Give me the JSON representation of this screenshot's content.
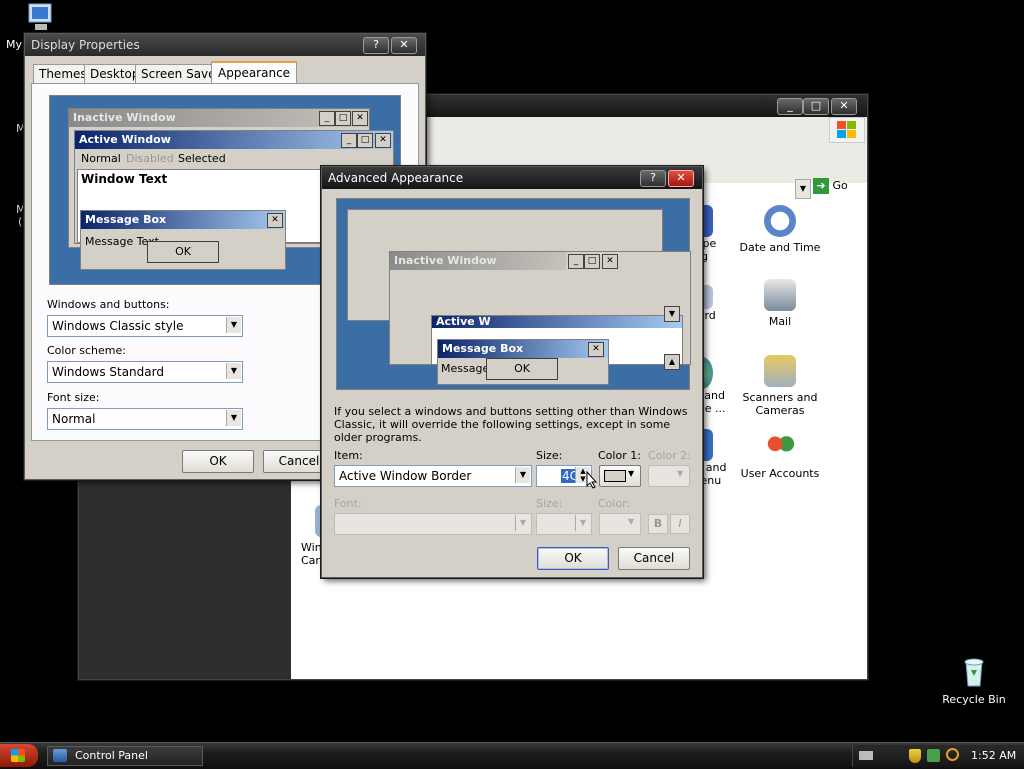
{
  "desktop": {
    "icons": {
      "my_computer_label": "My",
      "recycle_bin_label": "Recycle Bin"
    },
    "edge_letters": [
      "M",
      "M",
      "("
    ]
  },
  "control_panel": {
    "go_label": "Go",
    "items": [
      {
        "label": "Type\ning",
        "icon": "font-icon"
      },
      {
        "label": "Date and Time",
        "icon": "clock-icon"
      },
      {
        "label": "oard",
        "icon": "keyboard-icon"
      },
      {
        "label": "Mail",
        "icon": "mail-icon"
      },
      {
        "label": "al and\nage ...",
        "icon": "globe-icon"
      },
      {
        "label": "Scanners and\nCameras",
        "icon": "scanner-icon"
      },
      {
        "label": "ar and\nMenu",
        "icon": "taskbar-icon"
      },
      {
        "label": "User Accounts",
        "icon": "users-icon"
      },
      {
        "label": "Win\nCar",
        "icon": "card-icon"
      }
    ]
  },
  "display_properties": {
    "title": "Display Properties",
    "help": "?",
    "close": "✕",
    "tabs": [
      "Themes",
      "Desktop",
      "Screen Saver",
      "Appearance"
    ],
    "active_tab": "Appearance",
    "preview": {
      "inactive_window": "Inactive Window",
      "active_window": "Active Window",
      "menu": [
        "Normal",
        "Disabled",
        "Selected"
      ],
      "window_text": "Window Text",
      "message_box": "Message Box",
      "message_text": "Message Text",
      "ok": "OK"
    },
    "windows_buttons_label": "Windows and buttons:",
    "windows_buttons_value": "Windows Classic style",
    "color_scheme_label": "Color scheme:",
    "color_scheme_value": "Windows Standard",
    "font_size_label": "Font size:",
    "font_size_value": "Normal",
    "ok": "OK",
    "cancel": "Cancel"
  },
  "advanced": {
    "title": "Advanced Appearance",
    "help": "?",
    "close": "✕",
    "preview": {
      "inactive_window": "Inactive Window",
      "active_window": "Active W",
      "message_box": "Message Box",
      "message_text": "Message",
      "ok": "OK"
    },
    "note": "If you select a windows and buttons setting other than Windows Classic, it will override the following settings, except in some older programs.",
    "item_label": "Item:",
    "item_value": "Active Window Border",
    "size_label": "Size:",
    "size_value": "4C",
    "color1_label": "Color 1:",
    "color2_label": "Color 2:",
    "font_label": "Font:",
    "font_size_label": "Size:",
    "font_color_label": "Color:",
    "bold": "B",
    "italic": "I",
    "ok": "OK",
    "cancel": "Cancel"
  },
  "taskbar": {
    "start": "start",
    "task": "Control Panel",
    "clock": "1:52 AM"
  },
  "colors": {
    "preview_blue": "#3a6ea5",
    "active_title": "#0a246a",
    "desktop": "#000000"
  }
}
